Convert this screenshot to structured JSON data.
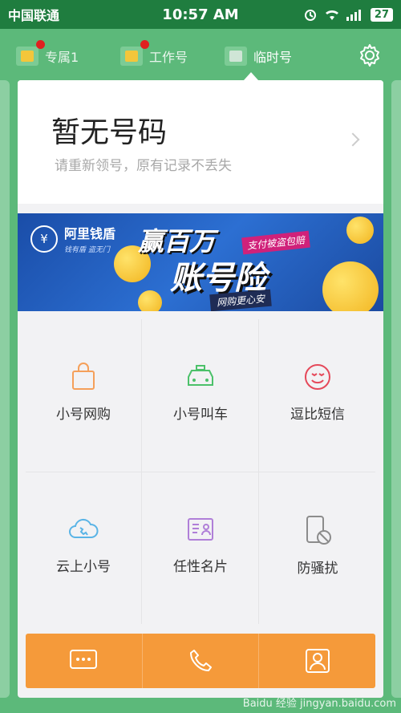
{
  "status_bar": {
    "carrier": "中国联通",
    "time": "10:57 AM",
    "battery": "27"
  },
  "tabs": [
    {
      "label": "专属1"
    },
    {
      "label": "工作号"
    },
    {
      "label": "临时号"
    }
  ],
  "number_card": {
    "title": "暂无号码",
    "subtitle": "请重新领号，原有记录不丢失"
  },
  "banner": {
    "brand": "阿里钱盾",
    "slogan": "钱有盾 盗无门",
    "headline1": "赢百万",
    "headline2": "账号险",
    "tag_top": "支付被盗包赔",
    "tag_bottom": "网购更心安"
  },
  "features": [
    {
      "label": "小号网购",
      "icon": "shopping-bag-icon",
      "color": "#f5a05a"
    },
    {
      "label": "小号叫车",
      "icon": "taxi-icon",
      "color": "#4cc16a"
    },
    {
      "label": "逗比短信",
      "icon": "smiley-icon",
      "color": "#e5495a"
    },
    {
      "label": "云上小号",
      "icon": "cloud-phone-icon",
      "color": "#5ab4e6"
    },
    {
      "label": "任性名片",
      "icon": "business-card-icon",
      "color": "#b07fd8"
    },
    {
      "label": "防骚扰",
      "icon": "block-phone-icon",
      "color": "#8c8c8c"
    }
  ],
  "bottom_bar": [
    {
      "icon": "message-icon"
    },
    {
      "icon": "phone-icon"
    },
    {
      "icon": "contacts-icon"
    }
  ],
  "watermark": "Baidu 经验 jingyan.baidu.com",
  "colors": {
    "accent_green": "#5cb97a",
    "status_green": "#1f7d3f",
    "bottom_orange": "#f59a3a"
  }
}
